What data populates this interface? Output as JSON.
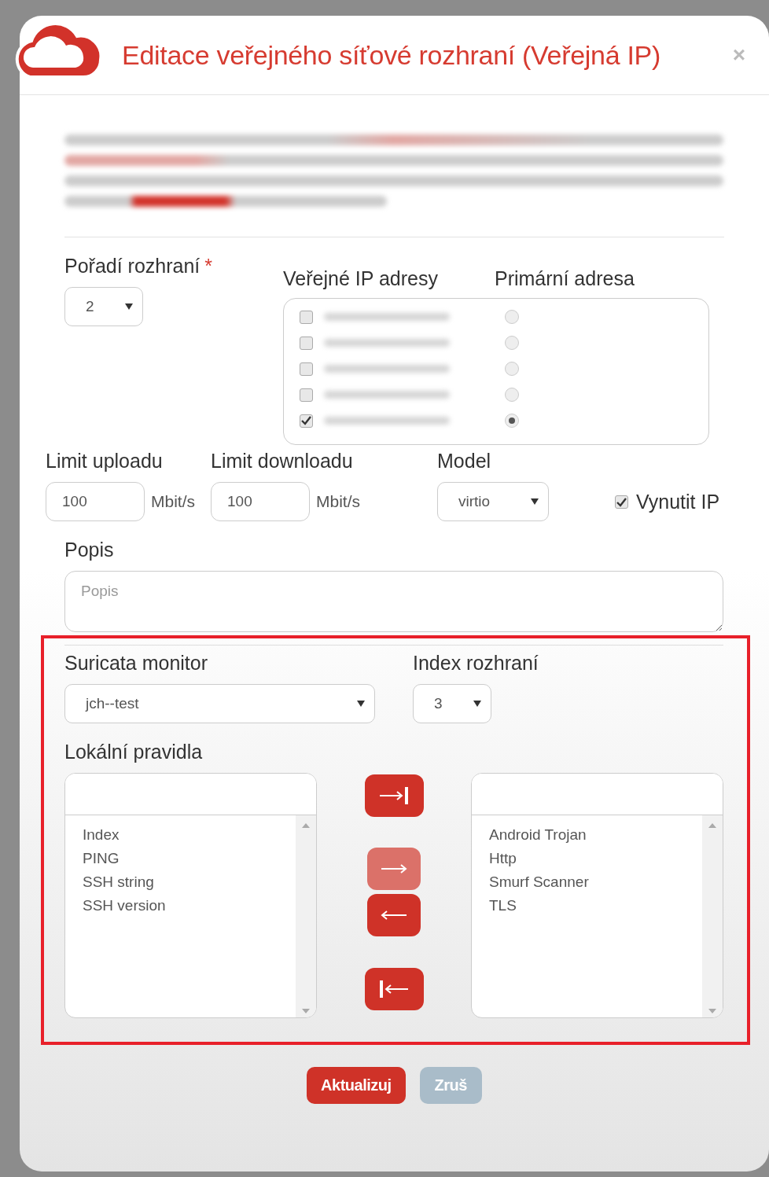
{
  "dialog": {
    "title": "Editace veřejného síťové rozhraní (Veřejná IP)",
    "close": "×"
  },
  "interface_order": {
    "label": "Pořadí rozhraní",
    "required_mark": "*",
    "value": "2"
  },
  "public_ips": {
    "label": "Veřejné IP adresy",
    "primary_label": "Primární adresa",
    "items": [
      {
        "checked": false,
        "selected": false
      },
      {
        "checked": false,
        "selected": false
      },
      {
        "checked": false,
        "selected": false
      },
      {
        "checked": false,
        "selected": false
      },
      {
        "checked": true,
        "selected": true
      }
    ]
  },
  "upload": {
    "label": "Limit uploadu",
    "value": "100",
    "unit": "Mbit/s"
  },
  "download": {
    "label": "Limit downloadu",
    "value": "100",
    "unit": "Mbit/s"
  },
  "model": {
    "label": "Model",
    "value": "virtio"
  },
  "force_ip": {
    "label": "Vynutit IP",
    "checked": true
  },
  "description": {
    "label": "Popis",
    "placeholder": "Popis"
  },
  "suricata": {
    "label": "Suricata monitor",
    "value": "jch--test"
  },
  "interface_index": {
    "label": "Index rozhraní",
    "value": "3"
  },
  "local_rules": {
    "label": "Lokální pravidla",
    "available": [
      "Index",
      "PING",
      "SSH string",
      "SSH version"
    ],
    "selected_rules": [
      "Android Trojan",
      "Http",
      "Smurf Scanner",
      "TLS"
    ],
    "move_buttons": [
      {
        "kind": "all-right",
        "disabled": false
      },
      {
        "kind": "right",
        "disabled": true
      },
      {
        "kind": "left",
        "disabled": false
      },
      {
        "kind": "all-left",
        "disabled": false
      }
    ]
  },
  "buttons": [
    {
      "label": "Aktualizuj",
      "kind": "primary"
    },
    {
      "label": "Zruš",
      "kind": "secondary"
    }
  ]
}
